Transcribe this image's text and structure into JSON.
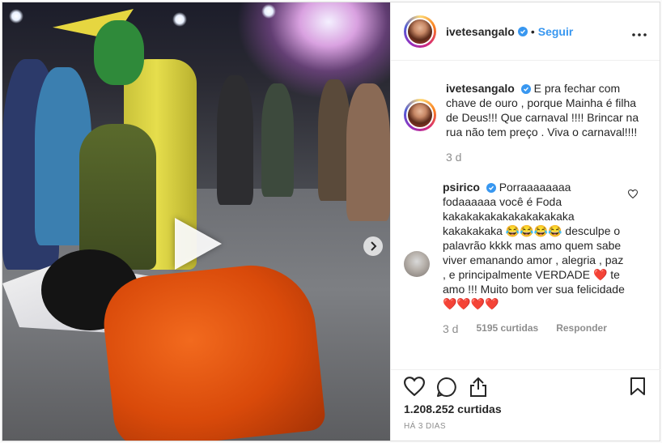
{
  "account": {
    "username": "ivetesangalo",
    "follow_label": "Seguir",
    "separator": "•"
  },
  "caption": {
    "username": "ivetesangalo",
    "text": "E pra fechar com chave de ouro , porque Mainha é filha de Deus!!! Que carnaval !!!! Brincar na rua não tem preço . Viva o carnaval!!!!",
    "time": "3 d"
  },
  "comments": [
    {
      "username": "psirico",
      "text": "Porraaaaaaaa fodaaaaaa você é Foda kakakakakakakakakakaka kakakakaka 😂😂😂😂 desculpe o palavrão kkkk mas amo quem sabe viver emanando amor , alegria , paz , e principalmente VERDADE ❤️ te amo !!! Muito bom ver sua felicidade ❤️❤️❤️❤️",
      "time": "3 d",
      "likes": "5195 curtidas",
      "reply_label": "Responder"
    }
  ],
  "post": {
    "likes": "1.208.252 curtidas",
    "posted": "HÁ 3 DIAS"
  },
  "icons": {
    "verified": "verified-badge-icon",
    "more": "more-options-icon",
    "play": "play-icon",
    "next": "chevron-right-icon",
    "like": "heart-icon",
    "comment": "comment-icon",
    "share": "share-icon",
    "save": "bookmark-icon"
  },
  "colors": {
    "accent": "#3897f0",
    "heart": "#ed4956",
    "muted": "#8e8e8e"
  }
}
